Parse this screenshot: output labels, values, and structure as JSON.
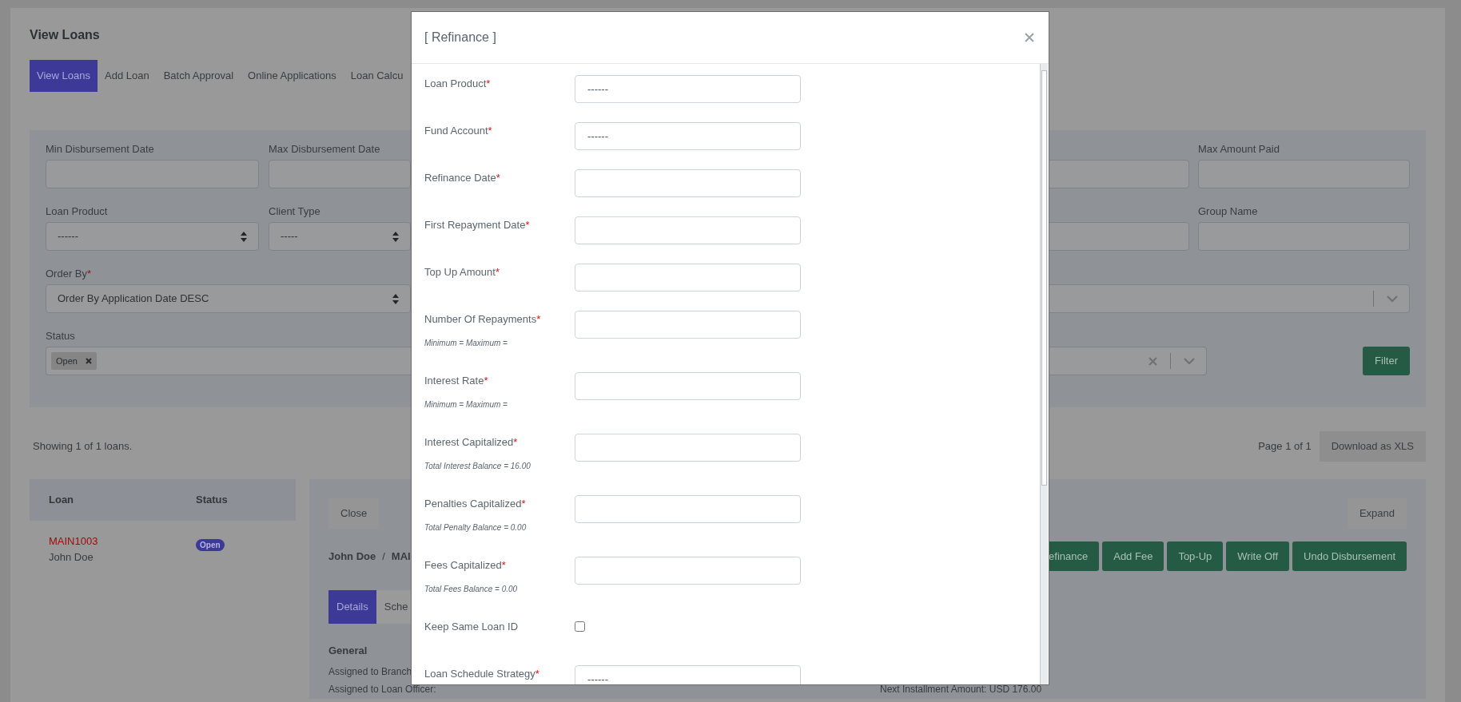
{
  "header": {
    "title": "View Loans"
  },
  "tabs": [
    {
      "label": "View Loans",
      "selected": true
    },
    {
      "label": "Add Loan",
      "selected": false
    },
    {
      "label": "Batch Approval",
      "selected": false
    },
    {
      "label": "Online Applications",
      "selected": false
    },
    {
      "label": "Loan Calcu",
      "selected": false
    }
  ],
  "filters": {
    "rows": [
      {
        "left": [
          {
            "kind": "input",
            "label": "Min Disbursement Date"
          },
          {
            "kind": "input",
            "label": "Max Disbursement Date"
          }
        ],
        "right": [
          {
            "kind": "input"
          },
          {
            "kind": "input",
            "label": "Max Amount Paid"
          }
        ]
      },
      {
        "left": [
          {
            "kind": "select",
            "label": "Loan Product",
            "value": "------"
          },
          {
            "kind": "select",
            "label": "Client Type",
            "value": "-----"
          }
        ],
        "right": [
          {
            "kind": "input"
          },
          {
            "kind": "input",
            "label": "Group Name"
          }
        ]
      },
      {
        "left": [
          {
            "kind": "select",
            "label": "Order By",
            "required_mark": "*",
            "value": "Order By Application Date DESC"
          }
        ],
        "right": [
          {
            "kind": "combo",
            "clearable": false
          }
        ]
      },
      {
        "left": [
          {
            "kind": "tags",
            "label": "Status",
            "tags": [
              "Open"
            ]
          }
        ],
        "right": [
          {
            "kind": "combo",
            "clearable": true
          },
          {
            "kind": "button",
            "label": "Filter"
          }
        ]
      }
    ]
  },
  "summary": {
    "text": "Showing 1 of 1 loans.",
    "page": "Page 1 of 1",
    "download": "Download as XLS"
  },
  "loans_table": {
    "columns": [
      "Loan",
      "Status"
    ],
    "rows": [
      {
        "loan_id": "MAIN1003",
        "client": "John Doe",
        "status": "Open"
      }
    ]
  },
  "detail": {
    "close": "Close",
    "expand": "Expand",
    "breadcrumb": [
      "John Doe",
      "/",
      "MAI"
    ],
    "actions": [
      "efinance",
      "Add Fee",
      "Top-Up",
      "Write Off",
      "Undo Disbursement"
    ],
    "tabs": [
      {
        "label": "Details",
        "selected": true
      },
      {
        "label": "Sche",
        "selected": false
      }
    ],
    "section": "General",
    "lines": [
      {
        "left": "Assigned to Branch"
      },
      {
        "left": "Assigned to Loan Officer:",
        "right": "Next Installment Amount: USD 176.00"
      }
    ]
  },
  "modal": {
    "title": "[ Refinance ]",
    "fields": [
      {
        "kind": "select",
        "label": "Loan Product",
        "required_mark": "*",
        "value": "------"
      },
      {
        "kind": "select",
        "label": "Fund Account",
        "required_mark": "*",
        "value": "------"
      },
      {
        "kind": "input",
        "label": "Refinance Date",
        "required_mark": "*"
      },
      {
        "kind": "input",
        "label": "First Repayment Date",
        "required_mark": "*"
      },
      {
        "kind": "input",
        "label": "Top Up Amount",
        "required_mark": "*"
      },
      {
        "kind": "input",
        "label": "Number Of Repayments",
        "required_mark": "*",
        "hint": "Minimum = Maximum ="
      },
      {
        "kind": "input",
        "label": "Interest Rate",
        "required_mark": "*",
        "hint": "Minimum = Maximum ="
      },
      {
        "kind": "input",
        "label": "Interest Capitalized",
        "required_mark": "*",
        "hint": "Total Interest Balance = 16.00"
      },
      {
        "kind": "input",
        "label": "Penalties Capitalized",
        "required_mark": "*",
        "hint": "Total Penalty Balance = 0.00"
      },
      {
        "kind": "input",
        "label": "Fees Capitalized",
        "required_mark": "*",
        "hint": "Total Fees Balance = 0.00"
      },
      {
        "kind": "checkbox",
        "label": "Keep Same Loan ID",
        "checked": false
      },
      {
        "kind": "select",
        "label": "Loan Schedule Strategy",
        "required_mark": "*",
        "value": "------"
      }
    ]
  }
}
